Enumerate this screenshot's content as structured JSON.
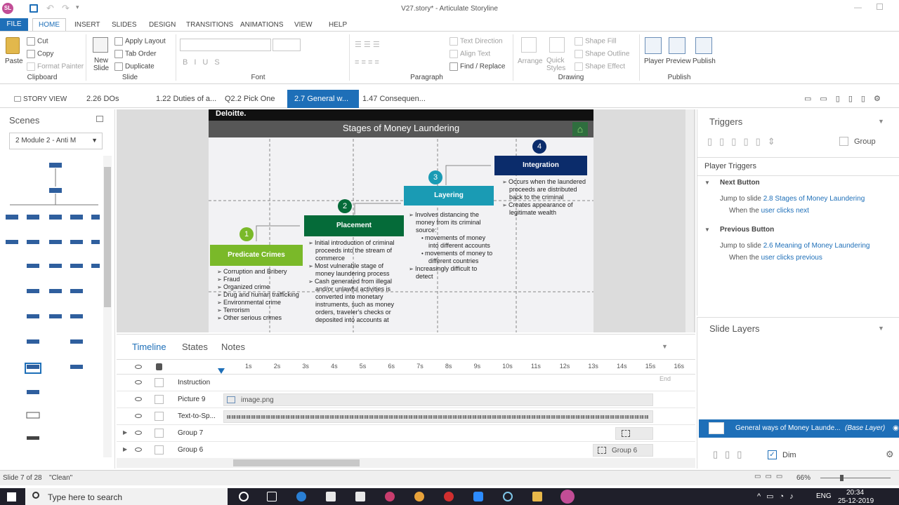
{
  "app": {
    "title": "V27.story* - Articulate Storyline",
    "logo": "SL"
  },
  "ribbon_tabs": [
    "FILE",
    "HOME",
    "INSERT",
    "SLIDES",
    "DESIGN",
    "TRANSITIONS",
    "ANIMATIONS",
    "VIEW",
    "HELP"
  ],
  "ribbon": {
    "clipboard": {
      "paste": "Paste",
      "cut": "Cut",
      "copy": "Copy",
      "format_painter": "Format Painter",
      "group": "Clipboard"
    },
    "slide": {
      "new_slide": "New Slide",
      "apply_layout": "Apply Layout",
      "tab_order": "Tab Order",
      "duplicate": "Duplicate",
      "group": "Slide"
    },
    "font": {
      "group": "Font"
    },
    "paragraph": {
      "text_direction": "Text Direction",
      "align_text": "Align Text",
      "find_replace": "Find / Replace",
      "group": "Paragraph"
    },
    "drawing": {
      "arrange": "Arrange",
      "quick_styles": "Quick Styles",
      "shape_fill": "Shape Fill",
      "shape_outline": "Shape Outline",
      "shape_effect": "Shape Effect",
      "group": "Drawing"
    },
    "publish": {
      "player": "Player",
      "preview": "Preview",
      "publish": "Publish",
      "group": "Publish"
    }
  },
  "slide_tabs": {
    "story_view": "STORY VIEW",
    "tabs": [
      "2.26 DOs",
      "1.22 Duties of a...",
      "Q2.2 Pick One",
      "2.7 General w...",
      "1.47 Consequen..."
    ],
    "active": 3
  },
  "scenes": {
    "title": "Scenes",
    "selected": "2 Module 2 - Anti M"
  },
  "slide": {
    "brand": "Deloitte.",
    "title": "Stages of Money Laundering",
    "stages": [
      {
        "num": "1",
        "label": "Predicate Crimes",
        "color": "#7ab929",
        "items": [
          "Corruption and Bribery",
          "Fraud",
          "Organized crime",
          "Drug and human trafficking",
          "Environmental crime",
          "Terrorism",
          "Other serious crimes"
        ]
      },
      {
        "num": "2",
        "label": "Placement",
        "color": "#056b39",
        "items": [
          "Initial introduction of criminal proceeds into the stream of commerce",
          "Most vulnerable stage of money laundering process",
          "Cash generated from illegal and/or unlawful activities is converted into monetary instruments, such as money orders, traveler's checks or deposited into accounts at"
        ]
      },
      {
        "num": "3",
        "label": "Layering",
        "color": "#1a9bb4",
        "items": [
          "Involves distancing the money from its criminal source:",
          "movements of money into different accounts",
          "movements of money to different countries",
          "Increasingly difficult to detect"
        ]
      },
      {
        "num": "4",
        "label": "Integration",
        "color": "#0b2c6b",
        "items": [
          "Occurs when the laundered proceeds are distributed back to the criminal",
          "Creates appearance of legitimate wealth"
        ]
      }
    ]
  },
  "triggers": {
    "title": "Triggers",
    "group_label": "Group",
    "player_triggers": "Player Triggers",
    "next": {
      "name": "Next Button",
      "action": "Jump to slide",
      "target": "2.8 Stages of Money Laundering",
      "when": "When the",
      "who": "user clicks",
      "event": "next"
    },
    "prev": {
      "name": "Previous Button",
      "action": "Jump to slide",
      "target": "2.6 Meaning of Money Laundering",
      "when": "When the",
      "who": "user clicks",
      "event": "previous"
    }
  },
  "layers": {
    "title": "Slide Layers",
    "base": "General ways of Money Launde...",
    "base_tag": "(Base Layer)",
    "dim": "Dim"
  },
  "timeline": {
    "tabs": [
      "Timeline",
      "States",
      "Notes"
    ],
    "ticks": [
      "1s",
      "2s",
      "3s",
      "4s",
      "5s",
      "6s",
      "7s",
      "8s",
      "9s",
      "10s",
      "11s",
      "12s",
      "13s",
      "14s",
      "15s",
      "16s"
    ],
    "end_label": "End",
    "rows": [
      {
        "label": "Instruction",
        "bar": ""
      },
      {
        "label": "Picture 9",
        "bar": "image.png"
      },
      {
        "label": "Text-to-Sp...",
        "bar": ""
      },
      {
        "label": "Group 7",
        "bar": ""
      },
      {
        "label": "Group 6",
        "bar": "Group 6"
      }
    ]
  },
  "status": {
    "slide": "Slide 7 of 28",
    "state": "\"Clean\"",
    "zoom": "66%"
  },
  "taskbar": {
    "search": "Type here to search",
    "lang": "ENG",
    "time": "20:34",
    "date": "25-12-2019"
  }
}
